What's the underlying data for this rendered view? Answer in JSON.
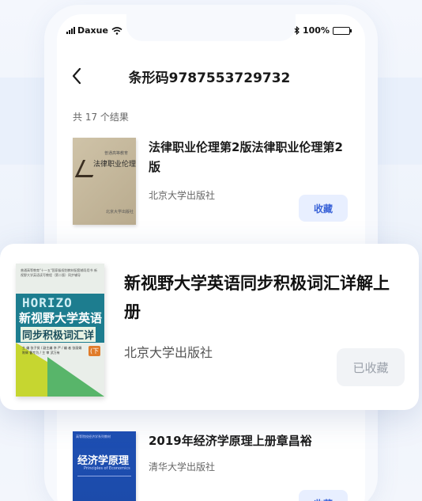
{
  "status_bar": {
    "carrier": "Daxue",
    "battery": "100%"
  },
  "header": {
    "title": "条形码9787553729732"
  },
  "results": {
    "count_text": "共 17 个结果"
  },
  "books": [
    {
      "title": "法律职业伦理第2版法律职业伦理第2版",
      "publisher": "北京大学出版社",
      "button": "收藏",
      "cover_text": "法律职业伦理",
      "cover_top": "普通高等教育",
      "cover_pub": "北京大学出版社"
    },
    {
      "title": "新视野大学英语同步积极词汇详解上册",
      "publisher": "北京大学出版社",
      "button": "已收藏",
      "cover_top": "普通高等教育\"十一五\"国家级规划教材配套辅导用书 新视野大学英语读写教程（第二版）同步辅导",
      "cover_horizon": "HORIZO",
      "cover_title1": "新视野大学英语",
      "cover_title2": "同步积极词汇详",
      "cover_tag": "(下",
      "cover_lines": "主 编 张子贤 / 副主编 李 严 / 编 者 张丽娟 陈辉 曹专为 / 主 审 武万有"
    },
    {
      "title": "2019年经济学原理上册章昌裕",
      "publisher": "清华大学出版社",
      "button": "收藏",
      "cover_top": "高等院校经济学系列教材",
      "cover_title": "经济学原理",
      "cover_sub": "Principles of Economics"
    }
  ],
  "colors": {
    "accent": "#3a63d8",
    "button_bg": "#e8efff",
    "disabled_bg": "#f1f3f6"
  }
}
